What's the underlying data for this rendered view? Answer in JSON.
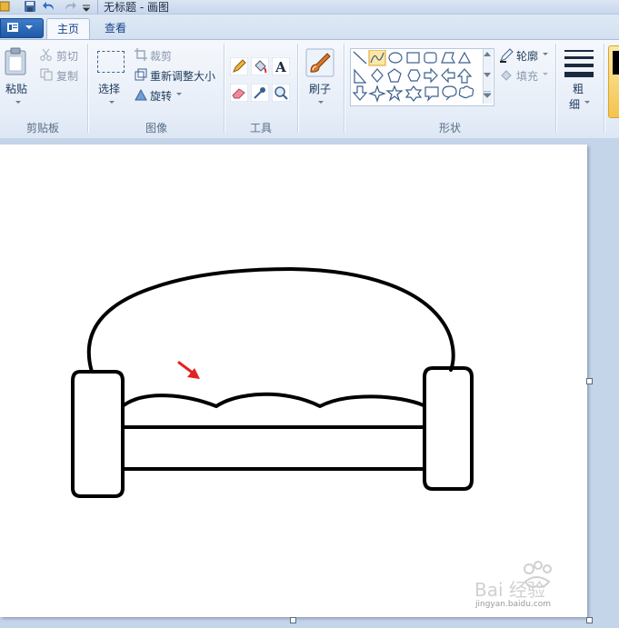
{
  "window": {
    "title": "无标题 - 画图"
  },
  "tabs": {
    "home": "主页",
    "view": "查看"
  },
  "clipboard": {
    "paste": "粘贴",
    "cut": "剪切",
    "copy": "复制",
    "group": "剪贴板"
  },
  "image": {
    "select": "选择",
    "crop": "裁剪",
    "resize": "重新调整大小",
    "rotate": "旋转",
    "group": "图像"
  },
  "tools": {
    "group": "工具",
    "text_glyph": "A"
  },
  "brushes": {
    "label": "刷子"
  },
  "shapes": {
    "outline": "轮廓",
    "fill": "填充",
    "group": "形状",
    "selected_shape": "curve"
  },
  "size": {
    "label_line1": "粗",
    "label_line2": "细"
  },
  "watermark": {
    "brand": "Bai 经验",
    "url": "jingyan.baidu.com"
  },
  "colors": {
    "arrow": "#e32222",
    "stroke": "#000000"
  }
}
